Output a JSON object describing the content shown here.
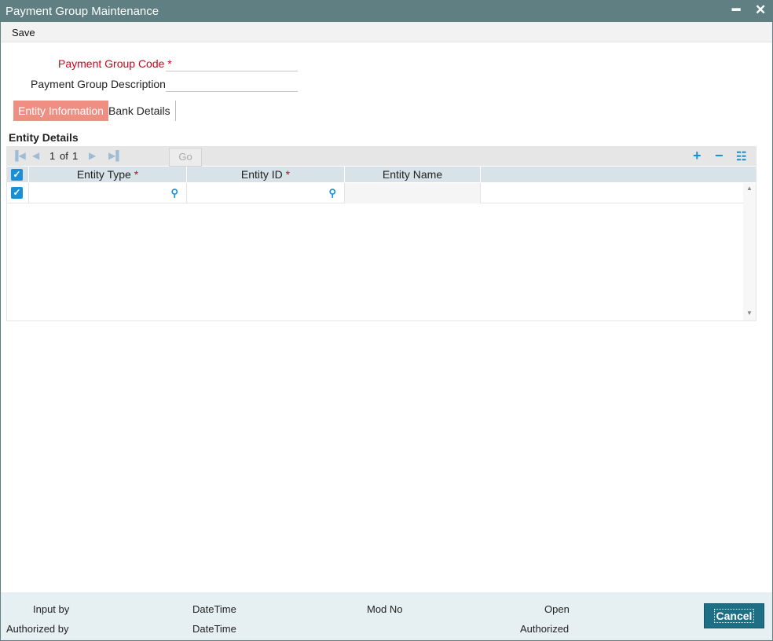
{
  "window": {
    "title": "Payment Group Maintenance",
    "minimize": "━",
    "close": "✕"
  },
  "toolbar": {
    "save_label": "Save"
  },
  "form": {
    "code_label": "Payment Group Code",
    "code_required": "*",
    "code_value": "",
    "description_label": "Payment Group Description",
    "description_value": ""
  },
  "tabs": [
    {
      "label": "Entity Information",
      "active": true
    },
    {
      "label": "Bank Details",
      "active": false
    }
  ],
  "entity_section": {
    "title": "Entity Details",
    "pager": {
      "page": "1",
      "of_label": "of",
      "total": "1",
      "go_label": "Go"
    },
    "columns": [
      {
        "label": "Entity Type",
        "required": "*"
      },
      {
        "label": "Entity ID",
        "required": "*"
      },
      {
        "label": "Entity Name",
        "required": ""
      }
    ],
    "rows": [
      {
        "checked": true,
        "entity_type": "",
        "entity_id": "",
        "entity_name": ""
      }
    ]
  },
  "footer": {
    "input_by": "Input by",
    "authorized_by": "Authorized by",
    "datetime_1": "DateTime",
    "datetime_2": "DateTime",
    "mod_no": "Mod No",
    "open": "Open",
    "authorized": "Authorized",
    "cancel_label": "Cancel"
  },
  "colors": {
    "titlebar": "#5f7f82",
    "active_tab": "#ef8f84",
    "accent": "#1a8fd1",
    "cancel": "#1d6f86"
  },
  "icons": [
    "first-page-icon",
    "prev-page-icon",
    "next-page-icon",
    "last-page-icon",
    "add-row-icon",
    "delete-row-icon",
    "single-view-icon",
    "search-icon",
    "checkbox-icon"
  ]
}
